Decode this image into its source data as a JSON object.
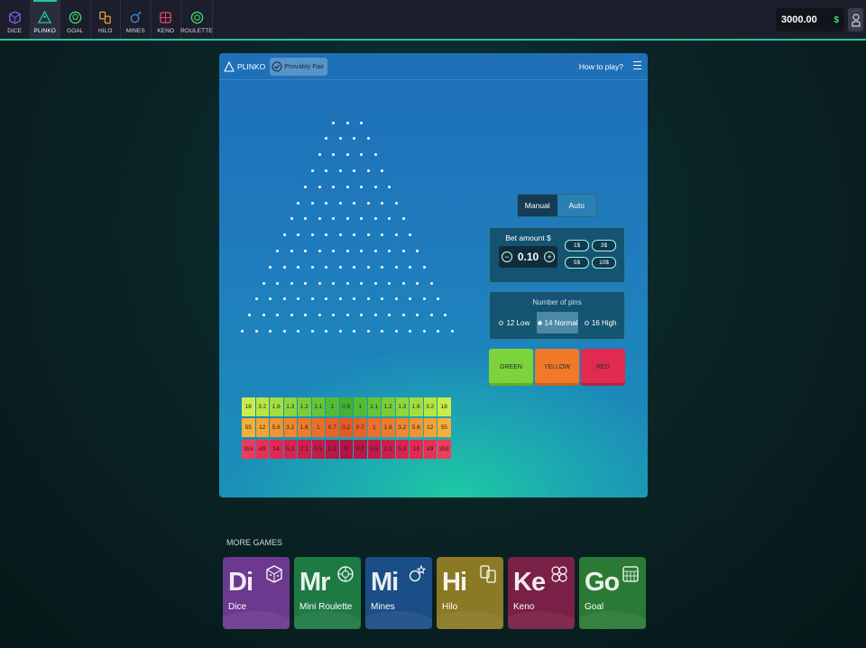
{
  "nav": [
    {
      "id": "dice",
      "label": "DICE",
      "icon": "dice-icon",
      "color": "#8a5cf6"
    },
    {
      "id": "plinko",
      "label": "PLINKO",
      "icon": "plinko-icon",
      "color": "#24c6a2",
      "active": true
    },
    {
      "id": "goal",
      "label": "GOAL",
      "icon": "goal-icon",
      "color": "#3ee06a"
    },
    {
      "id": "hilo",
      "label": "HILO",
      "icon": "hilo-icon",
      "color": "#f2a23a"
    },
    {
      "id": "mines",
      "label": "MINES",
      "icon": "mines-icon",
      "color": "#3a8ee6"
    },
    {
      "id": "keno",
      "label": "KENO",
      "icon": "keno-icon",
      "color": "#e64a6a"
    },
    {
      "id": "roulette",
      "label": "ROULETTE",
      "icon": "roulette-icon",
      "color": "#3ee06a"
    }
  ],
  "balance": {
    "value": "3000.00",
    "currency": "$"
  },
  "panel": {
    "title": "PLINKO",
    "provably_fair": "Provably Fair",
    "how_to_play": "How to play?"
  },
  "multipliers": {
    "green": [
      "18",
      "3.2",
      "1.6",
      "1.3",
      "1.2",
      "1.1",
      "1",
      "0.5",
      "1",
      "1.1",
      "1.2",
      "1.3",
      "1.6",
      "3.2",
      "18"
    ],
    "yellow": [
      "55",
      "12",
      "5.6",
      "3.2",
      "1.6",
      "1",
      "0.7",
      "0.2",
      "0.7",
      "1",
      "1.6",
      "3.2",
      "5.6",
      "12",
      "55"
    ],
    "red": [
      "353",
      "49",
      "14",
      "5.3",
      "2.1",
      "0.5",
      "0.2",
      "0",
      "0.2",
      "0.5",
      "2.1",
      "5.3",
      "14",
      "49",
      "353"
    ]
  },
  "controls": {
    "mode_manual": "Manual",
    "mode_auto": "Auto",
    "bet_label": "Bet amount $",
    "bet_value": "0.10",
    "minus": "−",
    "plus": "+",
    "quick": [
      "1$",
      "3$",
      "5$",
      "10$"
    ],
    "pins_label": "Number of pins",
    "pin_options": [
      "12 Low",
      "14 Normal",
      "16 High"
    ],
    "btn_green": "GREEN",
    "btn_yellow": "YELLOW",
    "btn_red": "RED"
  },
  "more_games": {
    "title": "MORE GAMES",
    "items": [
      {
        "abbr": "Di",
        "name": "Dice",
        "color": "#6b3a8e"
      },
      {
        "abbr": "Mr",
        "name": "Mini Roulette",
        "color": "#1d7a42"
      },
      {
        "abbr": "Mi",
        "name": "Mines",
        "color": "#1b4d86"
      },
      {
        "abbr": "Hi",
        "name": "Hilo",
        "color": "#8a7a25"
      },
      {
        "abbr": "Ke",
        "name": "Keno",
        "color": "#7a1f45"
      },
      {
        "abbr": "Go",
        "name": "Goal",
        "color": "#2a7a35"
      }
    ]
  }
}
